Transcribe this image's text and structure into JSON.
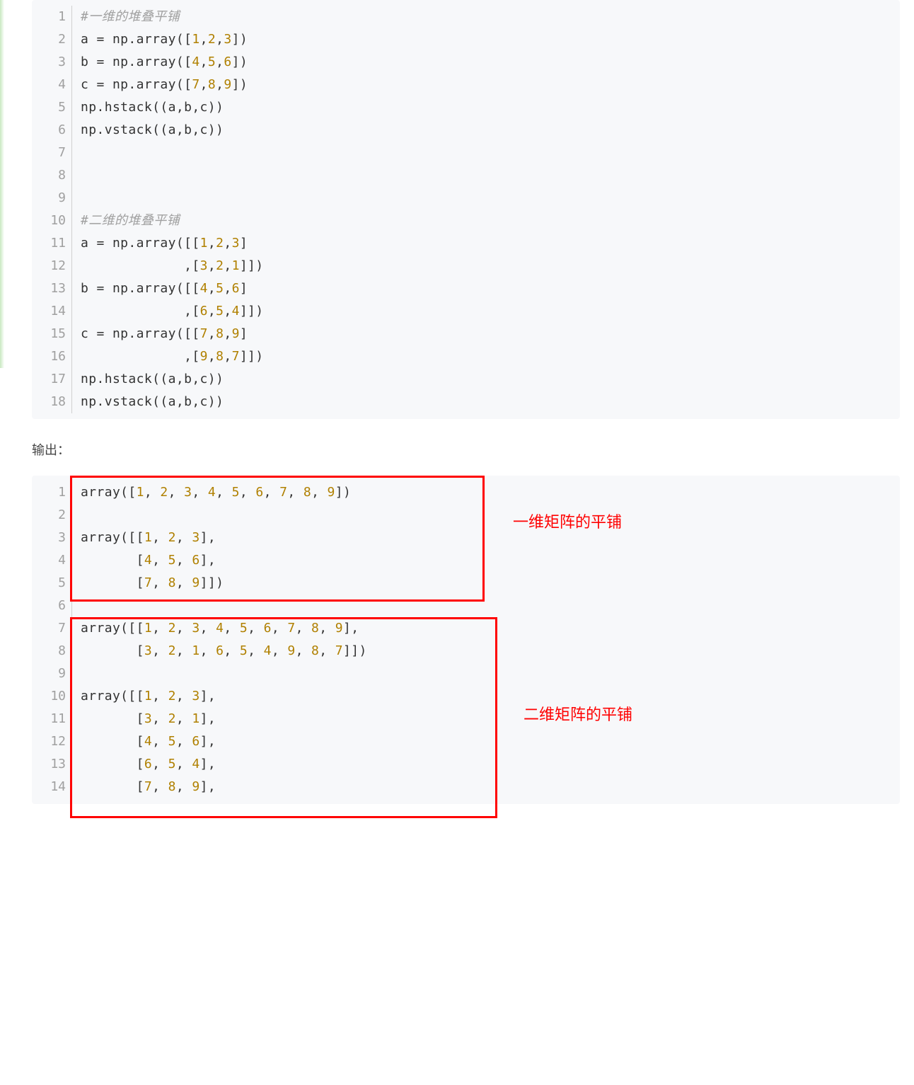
{
  "code1": {
    "lines": [
      {
        "n": "1",
        "tokens": [
          {
            "cls": "tok-comment",
            "t": "#一维的堆叠平铺"
          }
        ]
      },
      {
        "n": "2",
        "tokens": [
          {
            "cls": "tok-text",
            "t": "a = np.array(["
          },
          {
            "cls": "tok-num",
            "t": "1"
          },
          {
            "cls": "tok-text",
            "t": ","
          },
          {
            "cls": "tok-num",
            "t": "2"
          },
          {
            "cls": "tok-text",
            "t": ","
          },
          {
            "cls": "tok-num",
            "t": "3"
          },
          {
            "cls": "tok-text",
            "t": "])"
          }
        ]
      },
      {
        "n": "3",
        "tokens": [
          {
            "cls": "tok-text",
            "t": "b = np.array(["
          },
          {
            "cls": "tok-num",
            "t": "4"
          },
          {
            "cls": "tok-text",
            "t": ","
          },
          {
            "cls": "tok-num",
            "t": "5"
          },
          {
            "cls": "tok-text",
            "t": ","
          },
          {
            "cls": "tok-num",
            "t": "6"
          },
          {
            "cls": "tok-text",
            "t": "])"
          }
        ]
      },
      {
        "n": "4",
        "tokens": [
          {
            "cls": "tok-text",
            "t": "c = np.array(["
          },
          {
            "cls": "tok-num",
            "t": "7"
          },
          {
            "cls": "tok-text",
            "t": ","
          },
          {
            "cls": "tok-num",
            "t": "8"
          },
          {
            "cls": "tok-text",
            "t": ","
          },
          {
            "cls": "tok-num",
            "t": "9"
          },
          {
            "cls": "tok-text",
            "t": "])"
          }
        ]
      },
      {
        "n": "5",
        "tokens": [
          {
            "cls": "tok-text",
            "t": "np.hstack((a,b,c))"
          }
        ]
      },
      {
        "n": "6",
        "tokens": [
          {
            "cls": "tok-text",
            "t": "np.vstack((a,b,c))"
          }
        ]
      },
      {
        "n": "7",
        "tokens": []
      },
      {
        "n": "8",
        "tokens": []
      },
      {
        "n": "9",
        "tokens": []
      },
      {
        "n": "10",
        "tokens": [
          {
            "cls": "tok-comment",
            "t": "#二维的堆叠平铺"
          }
        ]
      },
      {
        "n": "11",
        "tokens": [
          {
            "cls": "tok-text",
            "t": "a = np.array([["
          },
          {
            "cls": "tok-num",
            "t": "1"
          },
          {
            "cls": "tok-text",
            "t": ","
          },
          {
            "cls": "tok-num",
            "t": "2"
          },
          {
            "cls": "tok-text",
            "t": ","
          },
          {
            "cls": "tok-num",
            "t": "3"
          },
          {
            "cls": "tok-text",
            "t": "]"
          }
        ]
      },
      {
        "n": "12",
        "tokens": [
          {
            "cls": "tok-text",
            "t": "             ,["
          },
          {
            "cls": "tok-num",
            "t": "3"
          },
          {
            "cls": "tok-text",
            "t": ","
          },
          {
            "cls": "tok-num",
            "t": "2"
          },
          {
            "cls": "tok-text",
            "t": ","
          },
          {
            "cls": "tok-num",
            "t": "1"
          },
          {
            "cls": "tok-text",
            "t": "]])"
          }
        ]
      },
      {
        "n": "13",
        "tokens": [
          {
            "cls": "tok-text",
            "t": "b = np.array([["
          },
          {
            "cls": "tok-num",
            "t": "4"
          },
          {
            "cls": "tok-text",
            "t": ","
          },
          {
            "cls": "tok-num",
            "t": "5"
          },
          {
            "cls": "tok-text",
            "t": ","
          },
          {
            "cls": "tok-num",
            "t": "6"
          },
          {
            "cls": "tok-text",
            "t": "]"
          }
        ]
      },
      {
        "n": "14",
        "tokens": [
          {
            "cls": "tok-text",
            "t": "             ,["
          },
          {
            "cls": "tok-num",
            "t": "6"
          },
          {
            "cls": "tok-text",
            "t": ","
          },
          {
            "cls": "tok-num",
            "t": "5"
          },
          {
            "cls": "tok-text",
            "t": ","
          },
          {
            "cls": "tok-num",
            "t": "4"
          },
          {
            "cls": "tok-text",
            "t": "]])"
          }
        ]
      },
      {
        "n": "15",
        "tokens": [
          {
            "cls": "tok-text",
            "t": "c = np.array([["
          },
          {
            "cls": "tok-num",
            "t": "7"
          },
          {
            "cls": "tok-text",
            "t": ","
          },
          {
            "cls": "tok-num",
            "t": "8"
          },
          {
            "cls": "tok-text",
            "t": ","
          },
          {
            "cls": "tok-num",
            "t": "9"
          },
          {
            "cls": "tok-text",
            "t": "]"
          }
        ]
      },
      {
        "n": "16",
        "tokens": [
          {
            "cls": "tok-text",
            "t": "             ,["
          },
          {
            "cls": "tok-num",
            "t": "9"
          },
          {
            "cls": "tok-text",
            "t": ","
          },
          {
            "cls": "tok-num",
            "t": "8"
          },
          {
            "cls": "tok-text",
            "t": ","
          },
          {
            "cls": "tok-num",
            "t": "7"
          },
          {
            "cls": "tok-text",
            "t": "]])"
          }
        ]
      },
      {
        "n": "17",
        "tokens": [
          {
            "cls": "tok-text",
            "t": "np.hstack((a,b,c))"
          }
        ]
      },
      {
        "n": "18",
        "tokens": [
          {
            "cls": "tok-text",
            "t": "np.vstack((a,b,c))"
          }
        ]
      }
    ]
  },
  "output_label": "输出：",
  "code2": {
    "lines": [
      {
        "n": "1",
        "tokens": [
          {
            "cls": "tok-text",
            "t": "array(["
          },
          {
            "cls": "tok-num",
            "t": "1"
          },
          {
            "cls": "tok-text",
            "t": ", "
          },
          {
            "cls": "tok-num",
            "t": "2"
          },
          {
            "cls": "tok-text",
            "t": ", "
          },
          {
            "cls": "tok-num",
            "t": "3"
          },
          {
            "cls": "tok-text",
            "t": ", "
          },
          {
            "cls": "tok-num",
            "t": "4"
          },
          {
            "cls": "tok-text",
            "t": ", "
          },
          {
            "cls": "tok-num",
            "t": "5"
          },
          {
            "cls": "tok-text",
            "t": ", "
          },
          {
            "cls": "tok-num",
            "t": "6"
          },
          {
            "cls": "tok-text",
            "t": ", "
          },
          {
            "cls": "tok-num",
            "t": "7"
          },
          {
            "cls": "tok-text",
            "t": ", "
          },
          {
            "cls": "tok-num",
            "t": "8"
          },
          {
            "cls": "tok-text",
            "t": ", "
          },
          {
            "cls": "tok-num",
            "t": "9"
          },
          {
            "cls": "tok-text",
            "t": "])"
          }
        ]
      },
      {
        "n": "2",
        "tokens": []
      },
      {
        "n": "3",
        "tokens": [
          {
            "cls": "tok-text",
            "t": "array([["
          },
          {
            "cls": "tok-num",
            "t": "1"
          },
          {
            "cls": "tok-text",
            "t": ", "
          },
          {
            "cls": "tok-num",
            "t": "2"
          },
          {
            "cls": "tok-text",
            "t": ", "
          },
          {
            "cls": "tok-num",
            "t": "3"
          },
          {
            "cls": "tok-text",
            "t": "],"
          }
        ]
      },
      {
        "n": "4",
        "tokens": [
          {
            "cls": "tok-text",
            "t": "       ["
          },
          {
            "cls": "tok-num",
            "t": "4"
          },
          {
            "cls": "tok-text",
            "t": ", "
          },
          {
            "cls": "tok-num",
            "t": "5"
          },
          {
            "cls": "tok-text",
            "t": ", "
          },
          {
            "cls": "tok-num",
            "t": "6"
          },
          {
            "cls": "tok-text",
            "t": "],"
          }
        ]
      },
      {
        "n": "5",
        "tokens": [
          {
            "cls": "tok-text",
            "t": "       ["
          },
          {
            "cls": "tok-num",
            "t": "7"
          },
          {
            "cls": "tok-text",
            "t": ", "
          },
          {
            "cls": "tok-num",
            "t": "8"
          },
          {
            "cls": "tok-text",
            "t": ", "
          },
          {
            "cls": "tok-num",
            "t": "9"
          },
          {
            "cls": "tok-text",
            "t": "]])"
          }
        ]
      },
      {
        "n": "6",
        "tokens": []
      },
      {
        "n": "7",
        "tokens": [
          {
            "cls": "tok-text",
            "t": "array([["
          },
          {
            "cls": "tok-num",
            "t": "1"
          },
          {
            "cls": "tok-text",
            "t": ", "
          },
          {
            "cls": "tok-num",
            "t": "2"
          },
          {
            "cls": "tok-text",
            "t": ", "
          },
          {
            "cls": "tok-num",
            "t": "3"
          },
          {
            "cls": "tok-text",
            "t": ", "
          },
          {
            "cls": "tok-num",
            "t": "4"
          },
          {
            "cls": "tok-text",
            "t": ", "
          },
          {
            "cls": "tok-num",
            "t": "5"
          },
          {
            "cls": "tok-text",
            "t": ", "
          },
          {
            "cls": "tok-num",
            "t": "6"
          },
          {
            "cls": "tok-text",
            "t": ", "
          },
          {
            "cls": "tok-num",
            "t": "7"
          },
          {
            "cls": "tok-text",
            "t": ", "
          },
          {
            "cls": "tok-num",
            "t": "8"
          },
          {
            "cls": "tok-text",
            "t": ", "
          },
          {
            "cls": "tok-num",
            "t": "9"
          },
          {
            "cls": "tok-text",
            "t": "],"
          }
        ]
      },
      {
        "n": "8",
        "tokens": [
          {
            "cls": "tok-text",
            "t": "       ["
          },
          {
            "cls": "tok-num",
            "t": "3"
          },
          {
            "cls": "tok-text",
            "t": ", "
          },
          {
            "cls": "tok-num",
            "t": "2"
          },
          {
            "cls": "tok-text",
            "t": ", "
          },
          {
            "cls": "tok-num",
            "t": "1"
          },
          {
            "cls": "tok-text",
            "t": ", "
          },
          {
            "cls": "tok-num",
            "t": "6"
          },
          {
            "cls": "tok-text",
            "t": ", "
          },
          {
            "cls": "tok-num",
            "t": "5"
          },
          {
            "cls": "tok-text",
            "t": ", "
          },
          {
            "cls": "tok-num",
            "t": "4"
          },
          {
            "cls": "tok-text",
            "t": ", "
          },
          {
            "cls": "tok-num",
            "t": "9"
          },
          {
            "cls": "tok-text",
            "t": ", "
          },
          {
            "cls": "tok-num",
            "t": "8"
          },
          {
            "cls": "tok-text",
            "t": ", "
          },
          {
            "cls": "tok-num",
            "t": "7"
          },
          {
            "cls": "tok-text",
            "t": "]])"
          }
        ]
      },
      {
        "n": "9",
        "tokens": []
      },
      {
        "n": "10",
        "tokens": [
          {
            "cls": "tok-text",
            "t": "array([["
          },
          {
            "cls": "tok-num",
            "t": "1"
          },
          {
            "cls": "tok-text",
            "t": ", "
          },
          {
            "cls": "tok-num",
            "t": "2"
          },
          {
            "cls": "tok-text",
            "t": ", "
          },
          {
            "cls": "tok-num",
            "t": "3"
          },
          {
            "cls": "tok-text",
            "t": "],"
          }
        ]
      },
      {
        "n": "11",
        "tokens": [
          {
            "cls": "tok-text",
            "t": "       ["
          },
          {
            "cls": "tok-num",
            "t": "3"
          },
          {
            "cls": "tok-text",
            "t": ", "
          },
          {
            "cls": "tok-num",
            "t": "2"
          },
          {
            "cls": "tok-text",
            "t": ", "
          },
          {
            "cls": "tok-num",
            "t": "1"
          },
          {
            "cls": "tok-text",
            "t": "],"
          }
        ]
      },
      {
        "n": "12",
        "tokens": [
          {
            "cls": "tok-text",
            "t": "       ["
          },
          {
            "cls": "tok-num",
            "t": "4"
          },
          {
            "cls": "tok-text",
            "t": ", "
          },
          {
            "cls": "tok-num",
            "t": "5"
          },
          {
            "cls": "tok-text",
            "t": ", "
          },
          {
            "cls": "tok-num",
            "t": "6"
          },
          {
            "cls": "tok-text",
            "t": "],"
          }
        ]
      },
      {
        "n": "13",
        "tokens": [
          {
            "cls": "tok-text",
            "t": "       ["
          },
          {
            "cls": "tok-num",
            "t": "6"
          },
          {
            "cls": "tok-text",
            "t": ", "
          },
          {
            "cls": "tok-num",
            "t": "5"
          },
          {
            "cls": "tok-text",
            "t": ", "
          },
          {
            "cls": "tok-num",
            "t": "4"
          },
          {
            "cls": "tok-text",
            "t": "],"
          }
        ]
      },
      {
        "n": "14",
        "tokens": [
          {
            "cls": "tok-text",
            "t": "       ["
          },
          {
            "cls": "tok-num",
            "t": "7"
          },
          {
            "cls": "tok-text",
            "t": ", "
          },
          {
            "cls": "tok-num",
            "t": "8"
          },
          {
            "cls": "tok-text",
            "t": ", "
          },
          {
            "cls": "tok-num",
            "t": "9"
          },
          {
            "cls": "tok-text",
            "t": "],"
          }
        ]
      }
    ]
  },
  "ann1": "一维矩阵的平铺",
  "ann2": "二维矩阵的平铺"
}
